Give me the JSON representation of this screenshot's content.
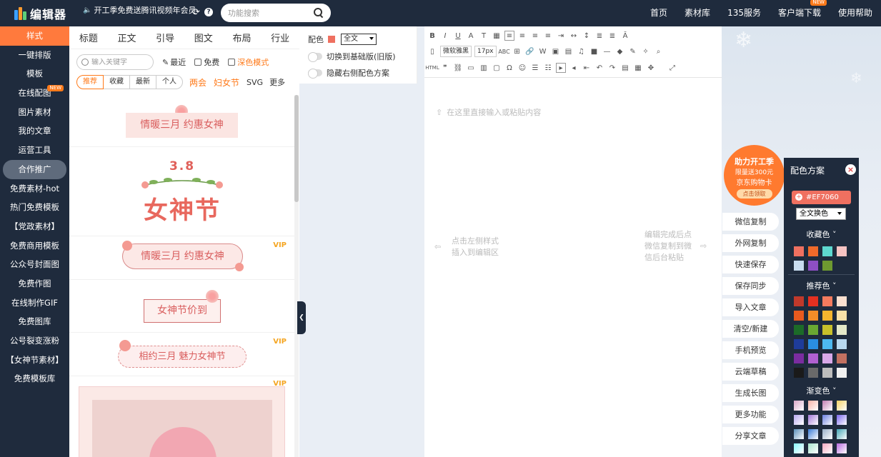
{
  "topbar": {
    "logo_text": "编辑器",
    "promo": "开工季免费送腾讯视频年会员",
    "search_placeholder": "功能搜索",
    "nav": [
      {
        "label": "首页",
        "new": false
      },
      {
        "label": "素材库",
        "new": false
      },
      {
        "label": "135服务",
        "new": false
      },
      {
        "label": "客户端下载",
        "new": true
      },
      {
        "label": "使用帮助",
        "new": false
      }
    ],
    "new_badge": "NEW"
  },
  "sidebar": {
    "items": [
      {
        "label": "样式",
        "active": true
      },
      {
        "label": "一键排版"
      },
      {
        "label": "模板"
      },
      {
        "label": "在线配图",
        "new": true
      },
      {
        "label": "图片素材"
      },
      {
        "label": "我的文章"
      },
      {
        "label": "运营工具"
      },
      {
        "label": "合作推广",
        "highlight": true
      },
      {
        "label": "免费素材-hot"
      },
      {
        "label": "热门免费模板"
      },
      {
        "label": "【党政素材】"
      },
      {
        "label": "免费商用模板"
      },
      {
        "label": "公众号封面图"
      },
      {
        "label": "免费作图"
      },
      {
        "label": "在线制作GIF"
      },
      {
        "label": "免费图库"
      },
      {
        "label": "公号裂变涨粉"
      },
      {
        "label": "【女神节素材】"
      },
      {
        "label": "免费模板库"
      }
    ]
  },
  "panel": {
    "categories": [
      "标题",
      "正文",
      "引导",
      "图文",
      "布局",
      "行业"
    ],
    "keyword_placeholder": "输入关键字",
    "recent": "最近",
    "free": "免费",
    "dark_mode": "深色模式",
    "sort": [
      "推荐",
      "收藏",
      "最新",
      "个人"
    ],
    "tags": [
      "两会",
      "妇女节"
    ],
    "svg": "SVG",
    "more": "更多",
    "vip": "VIP",
    "templates": {
      "t1": "情暖三月 约惠女神",
      "t2_date": "3.8",
      "t2_title": "女神节",
      "t3": "情暖三月 约惠女神",
      "t4": "女神节价到",
      "t5": "相约三月 魅力女神节"
    }
  },
  "colorbar": {
    "label": "配色",
    "swatch": "#EF7060",
    "scope": "全文",
    "toggle1": "切换到基础版(旧版)",
    "toggle2": "隐藏右侧配色方案"
  },
  "editor": {
    "font_name": "微软雅黑",
    "font_size": "17px",
    "placeholder": "在这里直接输入或粘贴内容",
    "hint_left": [
      "点击左侧样式",
      "插入到编辑区"
    ],
    "hint_right": [
      "编辑完成后点",
      "微信复制到微",
      "信后台粘贴"
    ]
  },
  "promo_badge": {
    "line1": "助力开工季",
    "line2": "限量送300元",
    "line3": "京东购物卡",
    "cta": "点击领取"
  },
  "functions": [
    "微信复制",
    "外网复制",
    "快速保存",
    "保存同步",
    "导入文章",
    "清空/新建",
    "手机预览",
    "云端草稿",
    "生成长图",
    "更多功能",
    "分享文章"
  ],
  "scheme": {
    "title": "配色方案",
    "color_value": "#EF7060",
    "scope": "全文换色",
    "collected_label": "收藏色",
    "collected": [
      "#EF7060",
      "#F06A2A",
      "#5ED8D0",
      "#F6C3C3",
      "#C8DCF0",
      "#8E4FC4",
      "#6E9A30"
    ],
    "recommended_label": "推荐色",
    "recommended": [
      "#C0392B",
      "#E53020",
      "#F47B5E",
      "#FBE0D0",
      "#E85A1E",
      "#F28C28",
      "#F5B52E",
      "#F9E1A8",
      "#1C6B28",
      "#6AA832",
      "#C8C02A",
      "#E4E8C8",
      "#1E3C9A",
      "#2A8EE0",
      "#4DB8F0",
      "#B8D8F0",
      "#7A2CA0",
      "#B060D0",
      "#D8A8E8",
      "#C27060",
      "#1A1A1A",
      "#6A6A6A",
      "#BDBDBD",
      "#F0F0F0"
    ],
    "gradient_label": "渐变色",
    "gradient": [
      "#D9A7C7",
      "#F8B3A8",
      "#C27EB2",
      "#F6D365",
      "#B8A9F0",
      "#A277D8",
      "#6A7FE0",
      "#7B68EE",
      "#5B8FB9",
      "#3A7BD5",
      "#9AB0C8",
      "#43A6B5",
      "#89F7FE",
      "#A8E6CF",
      "#F7A8C0",
      "#B86CE0"
    ]
  }
}
